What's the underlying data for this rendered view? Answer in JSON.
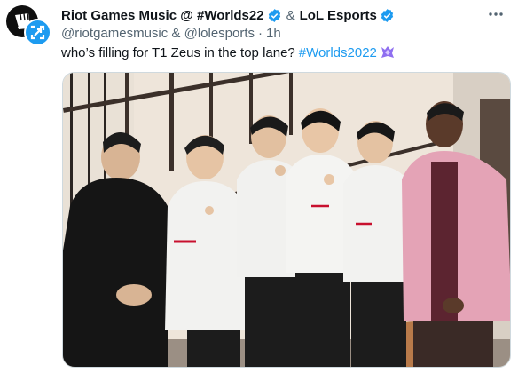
{
  "tweet": {
    "account_1": "Riot Games Music @ #Worlds22",
    "conjunction": "&",
    "account_2": "LoL Esports",
    "handles": "@riotgamesmusic & @lolesports",
    "separator": "·",
    "time": "1h",
    "text": "who’s filling for T1 Zeus in the top lane?",
    "hashtag": "#Worlds2022"
  },
  "icons": {
    "verified": "verified-badge-icon",
    "more": "more-options-icon",
    "hashflag": "worlds-hashflag-icon",
    "riot_avatar": "riot-fist-logo",
    "lol_avatar": "lol-esports-logo"
  },
  "colors": {
    "accent": "#1d9bf0",
    "text_primary": "#0f1419",
    "text_secondary": "#536471",
    "hashflag_purple": "#8f6ff0"
  }
}
